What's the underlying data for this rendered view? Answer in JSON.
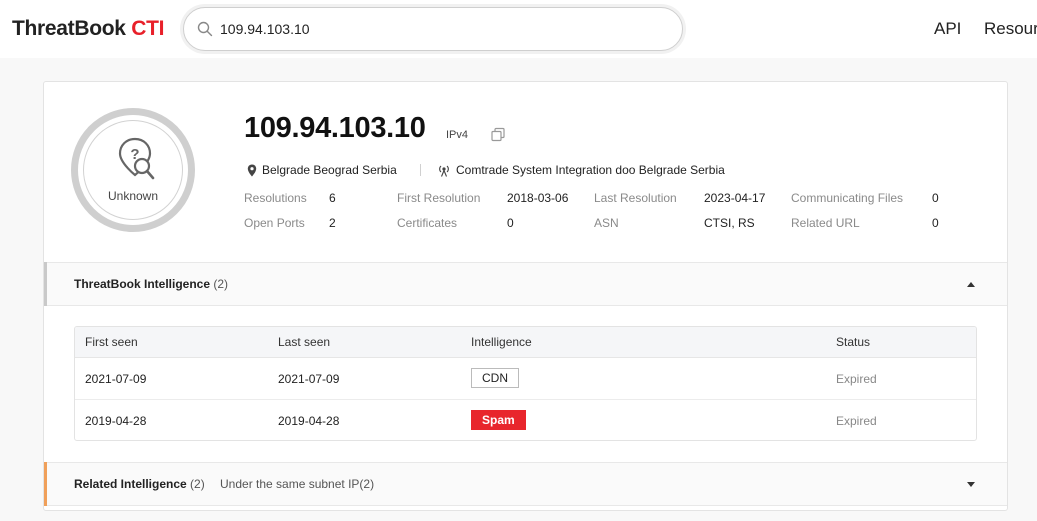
{
  "header": {
    "logo_main": "ThreatBook",
    "logo_accent": "CTI",
    "search_value": "109.94.103.10",
    "nav": [
      "API",
      "Resour"
    ]
  },
  "profile": {
    "badge_label": "Unknown",
    "ip": "109.94.103.10",
    "ip_version": "IPv4",
    "location": "Belgrade Beograd Serbia",
    "isp": "Comtrade System Integration doo Belgrade Serbia",
    "stats": [
      {
        "label": "Resolutions",
        "value": "6"
      },
      {
        "label": "First Resolution",
        "value": "2018-03-06"
      },
      {
        "label": "Last Resolution",
        "value": "2023-04-17"
      },
      {
        "label": "Communicating Files",
        "value": "0"
      },
      {
        "label": "Open Ports",
        "value": "2"
      },
      {
        "label": "Certificates",
        "value": "0"
      },
      {
        "label": "ASN",
        "value": "CTSI, RS"
      },
      {
        "label": "Related URL",
        "value": "0"
      }
    ]
  },
  "threatbook_intel": {
    "title": "ThreatBook Intelligence",
    "count": "(2)",
    "columns": [
      "First seen",
      "Last seen",
      "Intelligence",
      "Status"
    ],
    "rows": [
      {
        "first_seen": "2021-07-09",
        "last_seen": "2021-07-09",
        "intelligence": "CDN",
        "status": "Expired"
      },
      {
        "first_seen": "2019-04-28",
        "last_seen": "2019-04-28",
        "intelligence": "Spam",
        "status": "Expired"
      }
    ]
  },
  "related_intel": {
    "title": "Related Intelligence",
    "count": "(2)",
    "subtitle": "Under the same subnet IP(2)"
  },
  "colors": {
    "brand_red": "#e8202a",
    "spam_red": "#e8262c",
    "section_bar_gray": "#c9c9c9",
    "section_bar_orange": "#f0a05a"
  },
  "icons": [
    "search-icon",
    "question-location-icon",
    "copy-icon",
    "location-pin-icon",
    "isp-antenna-icon",
    "caret-up-icon",
    "caret-down-icon"
  ]
}
